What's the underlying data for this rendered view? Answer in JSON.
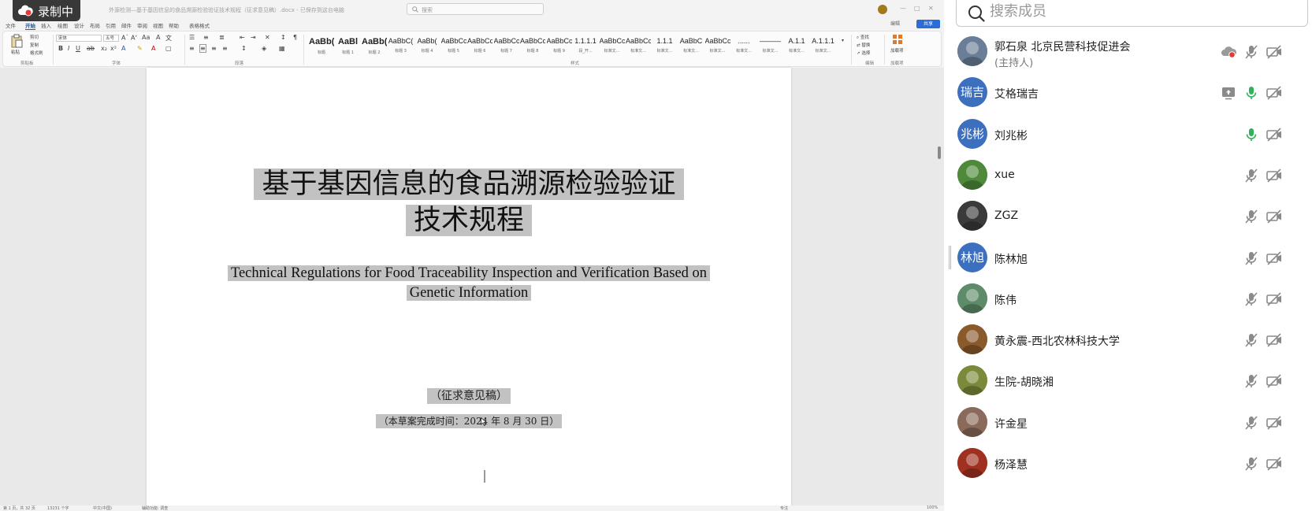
{
  "recording": {
    "label": "录制中"
  },
  "word": {
    "title_bar": {
      "doc_title": "外源检测—基于基因信息的食品溯源检验验证技术规程（征求意见稿）.docx - 已保存到这台电脑",
      "search_placeholder": "搜索"
    },
    "menu": {
      "items": [
        "文件",
        "开始",
        "插入",
        "绘图",
        "设计",
        "布局",
        "引用",
        "邮件",
        "审阅",
        "视图",
        "帮助",
        "表格格式"
      ],
      "active_index": 1,
      "edit_label": "编辑",
      "share_label": "共享"
    },
    "ribbon": {
      "clipboard": {
        "paste": "粘贴",
        "cut": "剪切",
        "copy": "复制",
        "format_painter": "格式刷",
        "group": "剪贴板"
      },
      "font": {
        "name": "宋体",
        "size": "五号",
        "group": "字体"
      },
      "paragraph": {
        "group": "段落"
      },
      "styles": {
        "group": "样式",
        "items": [
          {
            "sample": "AaBb(",
            "name": "标题",
            "big": true
          },
          {
            "sample": "AaBl",
            "name": "标题 1",
            "big": true
          },
          {
            "sample": "AaBb(",
            "name": "标题 2",
            "big": true
          },
          {
            "sample": "AaBbC(",
            "name": "标题 3",
            "big": false
          },
          {
            "sample": "AaBb(",
            "name": "标题 4",
            "big": false
          },
          {
            "sample": "AaBbCc",
            "name": "标题 5",
            "big": false
          },
          {
            "sample": "AaBbCc",
            "name": "标题 6",
            "big": false
          },
          {
            "sample": "AaBbCcD",
            "name": "标题 7",
            "big": false
          },
          {
            "sample": "AaBbCc",
            "name": "标题 8",
            "big": false
          },
          {
            "sample": "AaBbCc",
            "name": "标题 9",
            "big": false
          },
          {
            "sample": "1.1.1.1",
            "name": "段_开...",
            "big": false
          },
          {
            "sample": "AaBbCc",
            "name": "标准文...",
            "big": false
          },
          {
            "sample": "AaBbCc",
            "name": "标准文...",
            "big": false
          },
          {
            "sample": "1.1.1",
            "name": "标准文...",
            "big": false
          },
          {
            "sample": "AaBbC",
            "name": "标准文...",
            "big": false
          },
          {
            "sample": "AaBbCcDd",
            "name": "标准文...",
            "big": false
          },
          {
            "sample": "......",
            "name": "标准文...",
            "big": false
          },
          {
            "sample": "———",
            "name": "标准文...",
            "big": false
          },
          {
            "sample": "A.1.1",
            "name": "标准文...",
            "big": false
          },
          {
            "sample": "A.1.1.1",
            "name": "标准文...",
            "big": false
          }
        ]
      },
      "editing": {
        "find": "查找",
        "replace": "替换",
        "select": "选择",
        "group": "编辑"
      },
      "addins": {
        "label": "加载项",
        "group": "加载项"
      }
    },
    "document": {
      "title_line1": "基于基因信息的食品溯源检验验证",
      "title_line2": "技术规程",
      "english_line1": "Technical Regulations for Food Traceability Inspection and Verification Based on",
      "english_line2": "Genetic Information",
      "draft_label": "（征求意见稿）",
      "date_label": "（本草案完成时间：2024 年 8 月 30 日）"
    },
    "status_bar": {
      "page": "第 1 页，共 32 页",
      "words": "13231 个字",
      "lang": "中文(中国)",
      "accessibility": "辅助功能: 调查",
      "focus": "专注",
      "zoom": "100%"
    }
  },
  "meeting": {
    "search_placeholder": "搜索成员",
    "participants": [
      {
        "name": "郭石泉  北京民营科技促进会",
        "role": "(主持人)",
        "avatar_type": "photo",
        "avatar_text": "",
        "avatar_color": "#6a7f97",
        "mic": "muted",
        "cam": "off",
        "extra": "cloud-record"
      },
      {
        "name": "艾格瑞吉",
        "role": "",
        "avatar_type": "text",
        "avatar_text": "瑞吉",
        "avatar_color": "#3d6fbf",
        "mic": "on",
        "cam": "off",
        "extra": "screen-share"
      },
      {
        "name": "刘兆彬",
        "role": "",
        "avatar_type": "text",
        "avatar_text": "兆彬",
        "avatar_color": "#3d6fbf",
        "mic": "on",
        "cam": "off",
        "extra": ""
      },
      {
        "name": "xue",
        "role": "",
        "avatar_type": "photo",
        "avatar_text": "",
        "avatar_color": "#4e8a3a",
        "mic": "muted",
        "cam": "off",
        "extra": ""
      },
      {
        "name": "ZGZ",
        "role": "",
        "avatar_type": "photo",
        "avatar_text": "",
        "avatar_color": "#3a3a3a",
        "mic": "muted",
        "cam": "off",
        "extra": ""
      },
      {
        "name": "陈林旭",
        "role": "",
        "avatar_type": "text",
        "avatar_text": "林旭",
        "avatar_color": "#3d6fbf",
        "mic": "muted",
        "cam": "off",
        "extra": ""
      },
      {
        "name": "陈伟",
        "role": "",
        "avatar_type": "photo",
        "avatar_text": "",
        "avatar_color": "#5e8c6a",
        "mic": "muted",
        "cam": "off",
        "extra": ""
      },
      {
        "name": "黄永震-西北农林科技大学",
        "role": "",
        "avatar_type": "photo",
        "avatar_text": "",
        "avatar_color": "#8a5a2b",
        "mic": "muted",
        "cam": "off",
        "extra": ""
      },
      {
        "name": "生院-胡晓湘",
        "role": "",
        "avatar_type": "photo",
        "avatar_text": "",
        "avatar_color": "#7a8a3a",
        "mic": "muted",
        "cam": "off",
        "extra": ""
      },
      {
        "name": "许金星",
        "role": "",
        "avatar_type": "photo",
        "avatar_text": "",
        "avatar_color": "#8a6a5a",
        "mic": "muted",
        "cam": "off",
        "extra": ""
      },
      {
        "name": "杨泽慧",
        "role": "",
        "avatar_type": "photo",
        "avatar_text": "",
        "avatar_color": "#a03020",
        "mic": "muted",
        "cam": "off",
        "extra": ""
      }
    ]
  },
  "colors": {
    "mic_on": "#2fb35a",
    "icon_gray": "#8a8a8a",
    "rec_red": "#e53935",
    "accent": "#2b579a",
    "avatar_blue": "#3d6fbf"
  }
}
